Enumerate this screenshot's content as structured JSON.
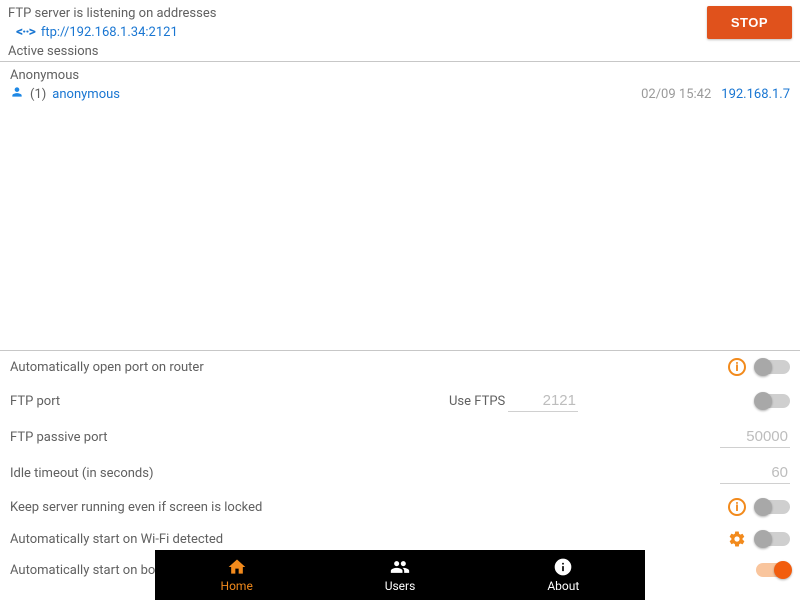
{
  "header": {
    "status_text": "FTP server is listening on addresses",
    "address": "ftp://192.168.1.34:2121",
    "stop_label": "STOP"
  },
  "sessions": {
    "heading": "Active sessions",
    "items": [
      {
        "display_name": "Anonymous",
        "count": "(1)",
        "username": "anonymous",
        "timestamp": "02/09 15:42",
        "client_ip": "192.168.1.7"
      }
    ]
  },
  "settings": {
    "rows": [
      {
        "label": "Automatically open port on router"
      },
      {
        "label": "FTP port",
        "port_value": "2121",
        "ftps_label": "Use FTPS"
      },
      {
        "label": "FTP passive port",
        "passive_value": "50000"
      },
      {
        "label": "Idle timeout (in seconds)",
        "idle_value": "60"
      },
      {
        "label": "Keep server running even if screen is locked"
      },
      {
        "label": "Automatically start on Wi-Fi detected"
      },
      {
        "label": "Automatically start on boot"
      }
    ],
    "toggles": {
      "auto_port": false,
      "use_ftps": false,
      "keep_running": false,
      "auto_wifi": false,
      "auto_boot": true
    }
  },
  "nav": {
    "items": [
      {
        "label": "Home"
      },
      {
        "label": "Users"
      },
      {
        "label": "About"
      }
    ]
  }
}
